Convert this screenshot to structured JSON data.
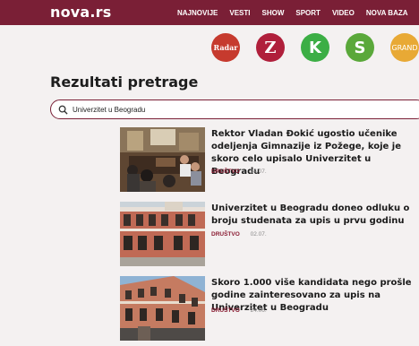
{
  "header": {
    "logo": "nova.rs",
    "nav": [
      "NAJNOVIJE",
      "VESTI",
      "SHOW",
      "SPORT",
      "VIDEO",
      "NOVA BAZA"
    ]
  },
  "brands": [
    {
      "name": "radar",
      "label": "Radar",
      "color": "#c63a2e"
    },
    {
      "name": "zena",
      "label": "Z",
      "color": "#b01f3b"
    },
    {
      "name": "kids",
      "label": "K",
      "color": "#3cae45"
    },
    {
      "name": "sport",
      "label": "S",
      "color": "#5aa83a"
    },
    {
      "name": "grand",
      "label": "GRAND",
      "color": "#e8a935"
    }
  ],
  "page": {
    "title": "Rezultati pretrage"
  },
  "search": {
    "value": "Univerzitet u Beogradu"
  },
  "results": [
    {
      "title": "Rektor Vladan Đokić ugostio učenike odeljenja Gimnazije iz Požege, koje je skoro celo upisalo Univerzitet u Beogradu",
      "category": "DRUŠTVO",
      "date": "14.07."
    },
    {
      "title": "Univerzitet u Beogradu doneo odluku o broju studenata za upis u prvu godinu",
      "category": "DRUŠTVO",
      "date": "02.07."
    },
    {
      "title": "Skoro 1.000 više kandidata nego prošle godine zainteresovano za upis na Univerzitet u Beogradu",
      "category": "DRUŠTVO",
      "date": "24.06."
    }
  ],
  "colors": {
    "brand": "#7a1f36",
    "category": "#8a1c33",
    "background": "#f4f1f1"
  }
}
